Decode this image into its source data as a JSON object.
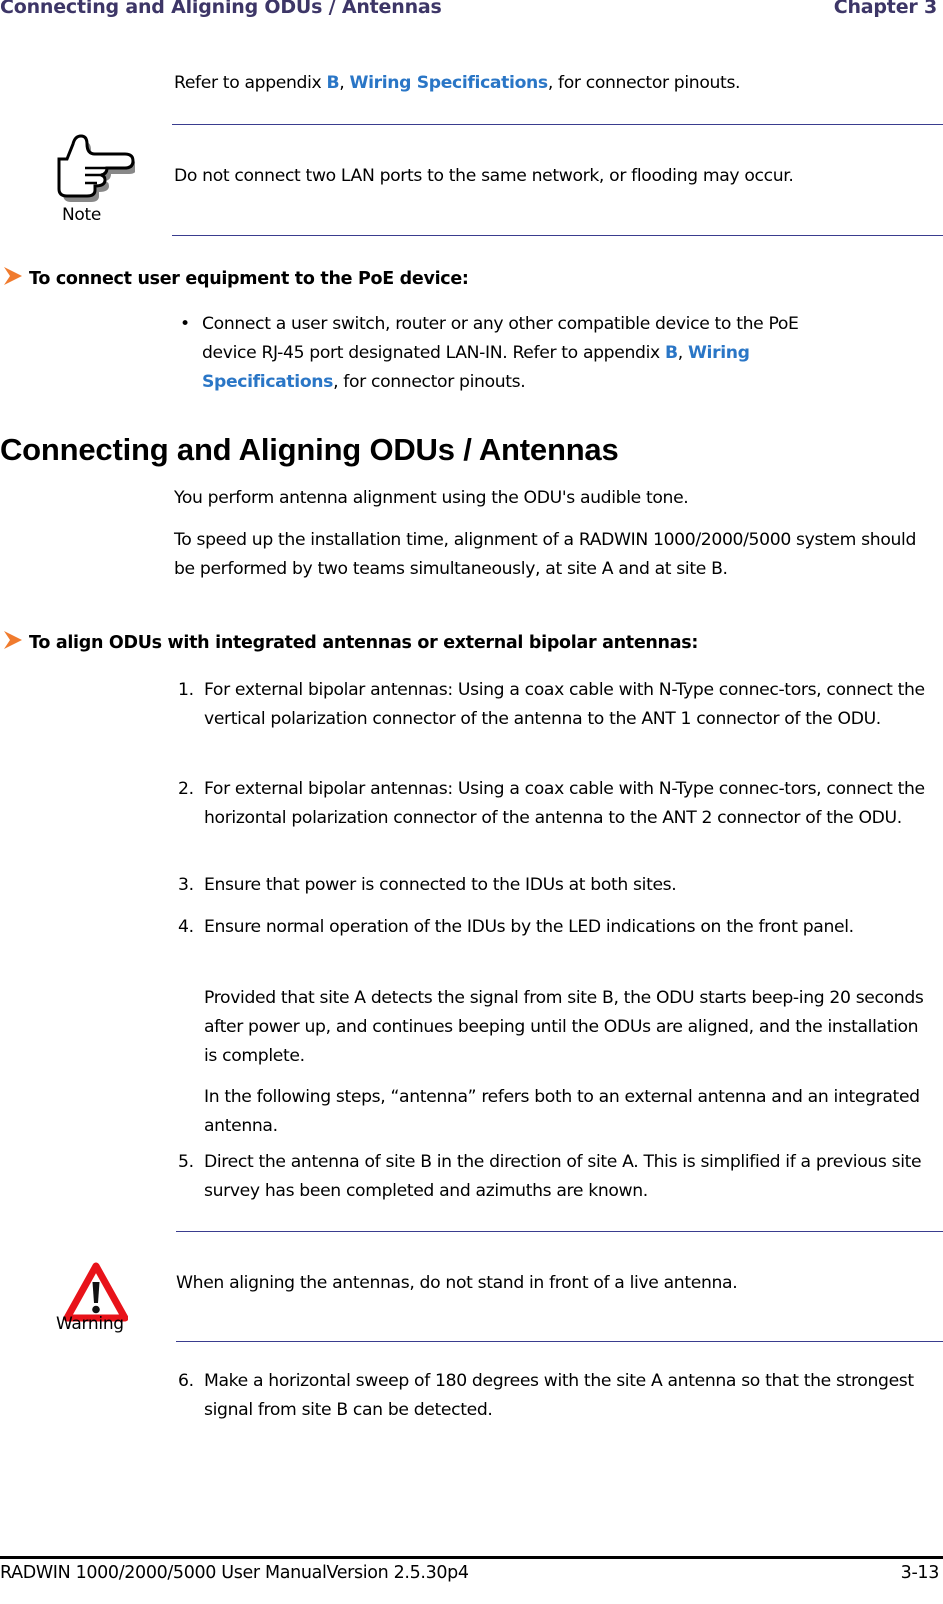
{
  "header": {
    "section": "Connecting and Aligning ODUs /  Antennas",
    "chapter": "Chapter 3"
  },
  "intro": {
    "pre": "Refer to appendix ",
    "link_b": "B",
    "sep": ", ",
    "link_spec": "Wiring Specifications",
    "post": ", for connector pinouts."
  },
  "note": {
    "icon": "pointing-hand-icon",
    "label": "Note",
    "text": "Do not connect two LAN ports to the same network, or flooding may occur."
  },
  "procedure1": {
    "heading": "To connect user equipment to the PoE device:",
    "bullet": "•",
    "item": {
      "line1": "Connect a user switch, router or any other compatible device to the PoE",
      "line2_pre": "device RJ-45 port designated LAN-IN. Refer to appendix ",
      "link_b": "B",
      "sep": ", ",
      "link_spec_1": "Wiring",
      "link_spec_2": "Specifications",
      "line3_post": ", for connector pinouts."
    }
  },
  "section": {
    "title": "Connecting and Aligning ODUs / Antennas",
    "para1": "You perform antenna alignment using the ODU's audible tone.",
    "para2": "To speed up the installation time, alignment of a RADWIN 1000/2000/5000 system should be performed by two teams simultaneously, at site A and at site B."
  },
  "procedure2": {
    "heading": "To align ODUs with integrated antennas or external bipolar antennas:",
    "steps": [
      {
        "num": "1.",
        "text": "For external bipolar antennas: Using a coax cable with N-Type connec-tors, connect the vertical polarization connector of the antenna to the ANT 1 connector of the ODU."
      },
      {
        "num": "2.",
        "text": "For external bipolar antennas: Using a coax cable with N-Type connec-tors, connect the horizontal polarization connector of the antenna to the ANT 2 connector of the ODU."
      },
      {
        "num": "3.",
        "text": "Ensure that power is connected to the IDUs at both sites."
      },
      {
        "num": "4.",
        "text": "Ensure normal operation of the IDUs by the LED indications on the front panel."
      },
      {
        "num": "5.",
        "text": "Direct the antenna of site B in the direction of site A. This is simplified if a previous site survey has been completed and azimuths are known."
      },
      {
        "num": "6.",
        "text": "Make a horizontal sweep of 180 degrees with the site A antenna so that the strongest signal from site B can be detected."
      }
    ],
    "step4_para1": "Provided that site A detects the signal from site B, the ODU starts beep-ing 20 seconds after power up, and continues beeping until the ODUs are aligned, and the installation is complete.",
    "step4_para2": "In the following steps, “antenna” refers both to an external antenna and an integrated antenna."
  },
  "warning": {
    "icon": "warning-triangle-icon",
    "label": "Warning",
    "text": "When aligning the antennas, do not stand in front of a live antenna."
  },
  "footer": {
    "manual": "RADWIN 1000/2000/5000 User ManualVersion  2.5.30p4",
    "page": "3-13"
  },
  "colors": {
    "header": "#3d3667",
    "link": "#2a76c6",
    "rule": "#3a3d8f",
    "arrow": "#f07b2e",
    "warning_red": "#e8131a"
  }
}
